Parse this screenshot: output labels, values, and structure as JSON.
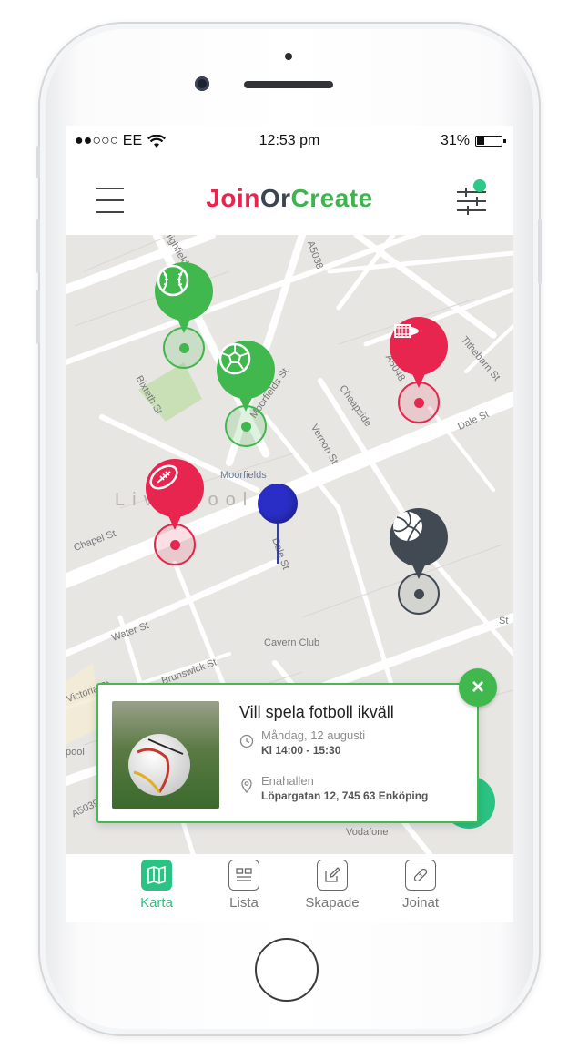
{
  "status_bar": {
    "carrier": "●●○○○ EE",
    "time": "12:53 pm",
    "battery": "31%",
    "battery_fraction": 0.31
  },
  "app_bar": {
    "brand_part1": "Join",
    "brand_part2": "Or",
    "brand_part3": "Create",
    "menu_icon": "hamburger-icon",
    "filter_icon": "sliders-icon"
  },
  "map": {
    "streets": [
      "Highfield",
      "A5038",
      "Tithebarn St",
      "Moorfields St",
      "Bixteth St",
      "Cheapside",
      "Vernon St",
      "A5048",
      "Dale St",
      "Moorfields",
      "Liverpool",
      "Chapel St",
      "Dale St",
      "St",
      "Water St",
      "Cavern Club",
      "Brunswick St",
      "Vodafone",
      "pool",
      "A5039",
      "Victoria St"
    ],
    "markers": [
      {
        "sport": "baseball",
        "color": "#41b84e",
        "icon": "baseball-icon"
      },
      {
        "sport": "soccer",
        "color": "#41b84e",
        "icon": "soccer-ball-icon"
      },
      {
        "sport": "badminton",
        "color": "#e8254e",
        "icon": "shuttlecock-icon"
      },
      {
        "sport": "american-football",
        "color": "#e8254e",
        "icon": "american-football-icon"
      },
      {
        "sport": "volleyball",
        "color": "#414a52",
        "icon": "volleyball-icon"
      }
    ],
    "user_location_color": "#2a2ec7"
  },
  "event_card": {
    "title": "Vill spela fotboll ikväll",
    "date": "Måndag, 12 augusti",
    "time": "Kl 14:00 - 15:30",
    "venue": "Enahallen",
    "address": "Löpargatan 12, 745 63 Enköping",
    "close_label": "×"
  },
  "bottom_nav": {
    "items": [
      {
        "label": "Karta",
        "icon": "map-icon",
        "active": true
      },
      {
        "label": "Lista",
        "icon": "list-icon",
        "active": false
      },
      {
        "label": "Skapade",
        "icon": "edit-icon",
        "active": false
      },
      {
        "label": "Joinat",
        "icon": "bandage-icon",
        "active": false
      }
    ]
  },
  "colors": {
    "accent_green": "#41b84e",
    "accent_red": "#e8254e",
    "dark": "#3b4550",
    "nav_active": "#2bc383"
  }
}
